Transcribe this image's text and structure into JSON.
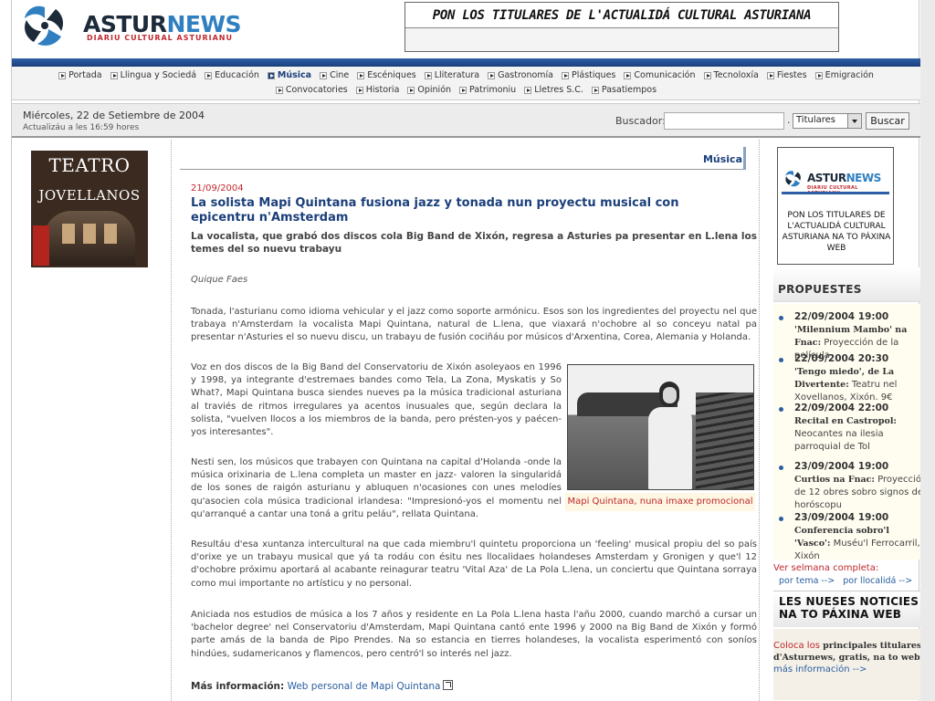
{
  "header": {
    "logo_asturnews_a": "ASTUR",
    "logo_asturnews_b": "NEWS",
    "logo_subtitle": "DIARIU CULTURAL ASTURIANU",
    "banner_text": "PON LOS TITULARES DE L'ACTUALIDÁ CULTURAL ASTURIANA",
    "colors": {
      "accent": "#2d5fa8",
      "brand_red": "#c0282d",
      "brand_blue": "#2f7fc1"
    }
  },
  "nav": {
    "row1": [
      "Portada",
      "Llingua y Sociedá",
      "Educación",
      "Música",
      "Cine",
      "Escéniques",
      "Lliteratura",
      "Gastronomía",
      "Plástiques",
      "Comunicación",
      "Tecnoloxía",
      "Fiestes",
      "Emigración"
    ],
    "row2": [
      "Convocatories",
      "Historia",
      "Opinión",
      "Patrimoniu",
      "Lletres S.C.",
      "Pasatiempos"
    ],
    "active": "Música"
  },
  "datebar": {
    "date": "Miércoles, 22 de Setiembre de 2004",
    "updated": "Actualizáu a les 16:59 hores",
    "search_label": "Buscador:",
    "search_value": "",
    "dot": ".",
    "select_value": "Titulares",
    "search_button": "Buscar"
  },
  "left": {
    "ad_line1": "TEATRO",
    "ad_line2": "JOVELLANOS"
  },
  "article": {
    "section": "Música",
    "date": "21/09/2004",
    "title": "La solista Mapi Quintana fusiona jazz y tonada nun proyectu musical con epicentru n'Amsterdam",
    "lead": "La vocalista, que grabó dos discos cola Big Band de Xixón, regresa a Asturies pa presentar en L.lena los temes del so nuevu trabayu",
    "author": "Quique Faes",
    "paragraphs": [
      "Tonada, l'asturianu como idioma vehicular y el jazz como soporte armónicu. Esos son los ingredientes del proyectu nel que trabaya n'Amsterdam la vocalista Mapi Quintana, natural de L.lena, que viaxará n'ochobre al so conceyu natal pa presentar n'Asturies el so nuevu discu, un trabayu de fusión cociñáu por músicos d'Arxentina, Corea, Alemania y Holanda.",
      "Voz en dos discos de la Big Band del Conservatoriu de Xixón asoleyaos en 1996 y 1998, ya integrante d'estremaes bandes como Tela, La Zona, Myskatis y So What?, Mapi Quintana busca siendes nueves pa la música tradicional asturiana al traviés de ritmos irregulares ya acentos inusuales que, según declara la solista, \"vuelven llocos a los miembros de la banda, pero présten-yos y paécen-yos interesantes\".",
      "Nesti sen, los músicos que trabayen con Quintana na capital d'Holanda -onde la música orixinaria de L.lena completa un master en jazz- valoren la singularidá de los sones de raigón asturianu y abluquen n'ocasiones con unes melodíes qu'asocien cola música tradicional irlandesa: \"Impresionó-yos el momentu nel qu'arranqué a cantar una toná a gritu peláu\", rellata Quintana.",
      "Resultáu d'esa xuntanza intercultural na que cada miembru'l quintetu proporciona un 'feeling' musical propiu del so país d'orixe ye un trabayu musical que yá ta rodáu con ésitu nes llocalidaes holandeses Amsterdam y Gronigen y que'l 12 d'ochobre próximu aportará al acabante reinagurar teatru 'Vital Aza' de La Pola L.lena, un conciertu que Quintana sorraya como mui importante no artísticu y no personal.",
      "Aniciada nos estudios de música a los 7 años y residente en La Pola L.lena hasta l'añu 2000, cuando marchó a cursar un 'bachelor degree' nel Conservatoriu d'Amsterdam, Mapi Quintana cantó ente 1996 y 2000 na Big Band de Xixón y formó parte amás de la banda de Pipo Prendes. Na so estancia en tierres holandeses, la vocalista esperimentó con soníos hindúes, sudamericanos y flamencos, pero centró'l so interés nel jazz."
    ],
    "photo_caption": "Mapi Quintana, nuna imaxe promocional",
    "more_label": "Más información:",
    "more_link": "Web personal de Mapi Quintana"
  },
  "right": {
    "ad_brand_a": "ASTUR",
    "ad_brand_b": "NEWS",
    "ad_subtitle": "DIARIU CULTURAL ASTURIANU",
    "ad_text": "PON LOS TITULARES DE L'ACTUALIDÁ CULTURAL ASTURIANA NA TO PÁXINA WEB",
    "propuestes_title": "PROPUESTES",
    "events": [
      {
        "date": "22/09/2004 19:00",
        "title": "'Milennium Mambo' na Fnac:",
        "desc": "Proyección de la película"
      },
      {
        "date": "22/09/2004 20:30",
        "title": "'Tengo miedo', de La Divertente:",
        "desc": "Teatru nel Xovellanos, Xixón. 9€"
      },
      {
        "date": "22/09/2004 22:00",
        "title": "Recital en Castropol:",
        "desc": "Neocantes na ilesia parroquial de Tol"
      },
      {
        "date": "23/09/2004 19:00",
        "title": "Curtios na Fnac:",
        "desc": "Proyección de 12 obres sobro signos del horóscopu"
      },
      {
        "date": "23/09/2004 19:00",
        "title": "Conferencia sobro'l 'Vasco':",
        "desc": "Muséu'l Ferrocarril, Xixón"
      }
    ],
    "week_label": "Ver selmana completa:",
    "week_link1": "por tema -->",
    "week_link2": "por llocalidá -->",
    "news_head": "LES NUESES NOTICIES NA TO PÁXINA WEB",
    "subs_red": "Coloca los",
    "subs_bold": "principales titulares d'Asturnews, gratis, na to web",
    "subs_link": "más información -->"
  }
}
